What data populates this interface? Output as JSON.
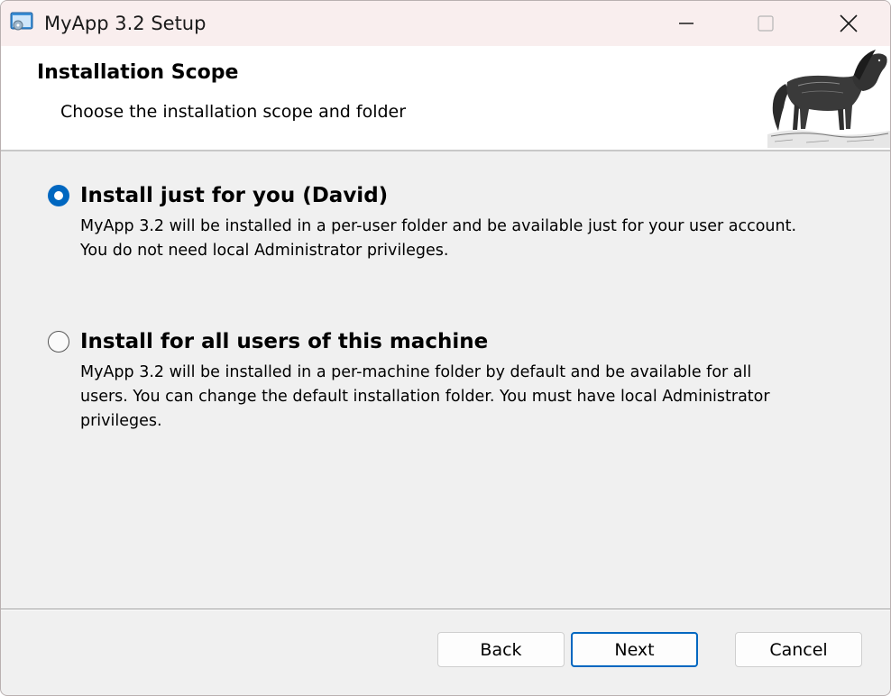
{
  "window": {
    "title": "MyApp 3.2 Setup",
    "icons": {
      "app": "installer-icon",
      "minimize": "minimize-icon",
      "maximize": "maximize-icon",
      "close": "close-icon"
    }
  },
  "banner": {
    "title": "Installation Scope",
    "subtitle": "Choose the installation scope and folder",
    "image": "horse-engraving-image"
  },
  "options": [
    {
      "label": "Install just for you (David)",
      "description": "MyApp 3.2 will be installed in a per-user folder and be available just for your user account. You do not need local Administrator privileges.",
      "selected": true
    },
    {
      "label": "Install for all users of this machine",
      "description": "MyApp 3.2 will be installed in a per-machine folder by default and be available for all users. You can change the default installation folder. You must have local Administrator privileges.",
      "selected": false
    }
  ],
  "footer": {
    "back_label": "Back",
    "next_label": "Next",
    "cancel_label": "Cancel"
  },
  "colors": {
    "accent": "#0067c0",
    "titlebar": "#f9eeee",
    "body": "#f0f0f0"
  }
}
